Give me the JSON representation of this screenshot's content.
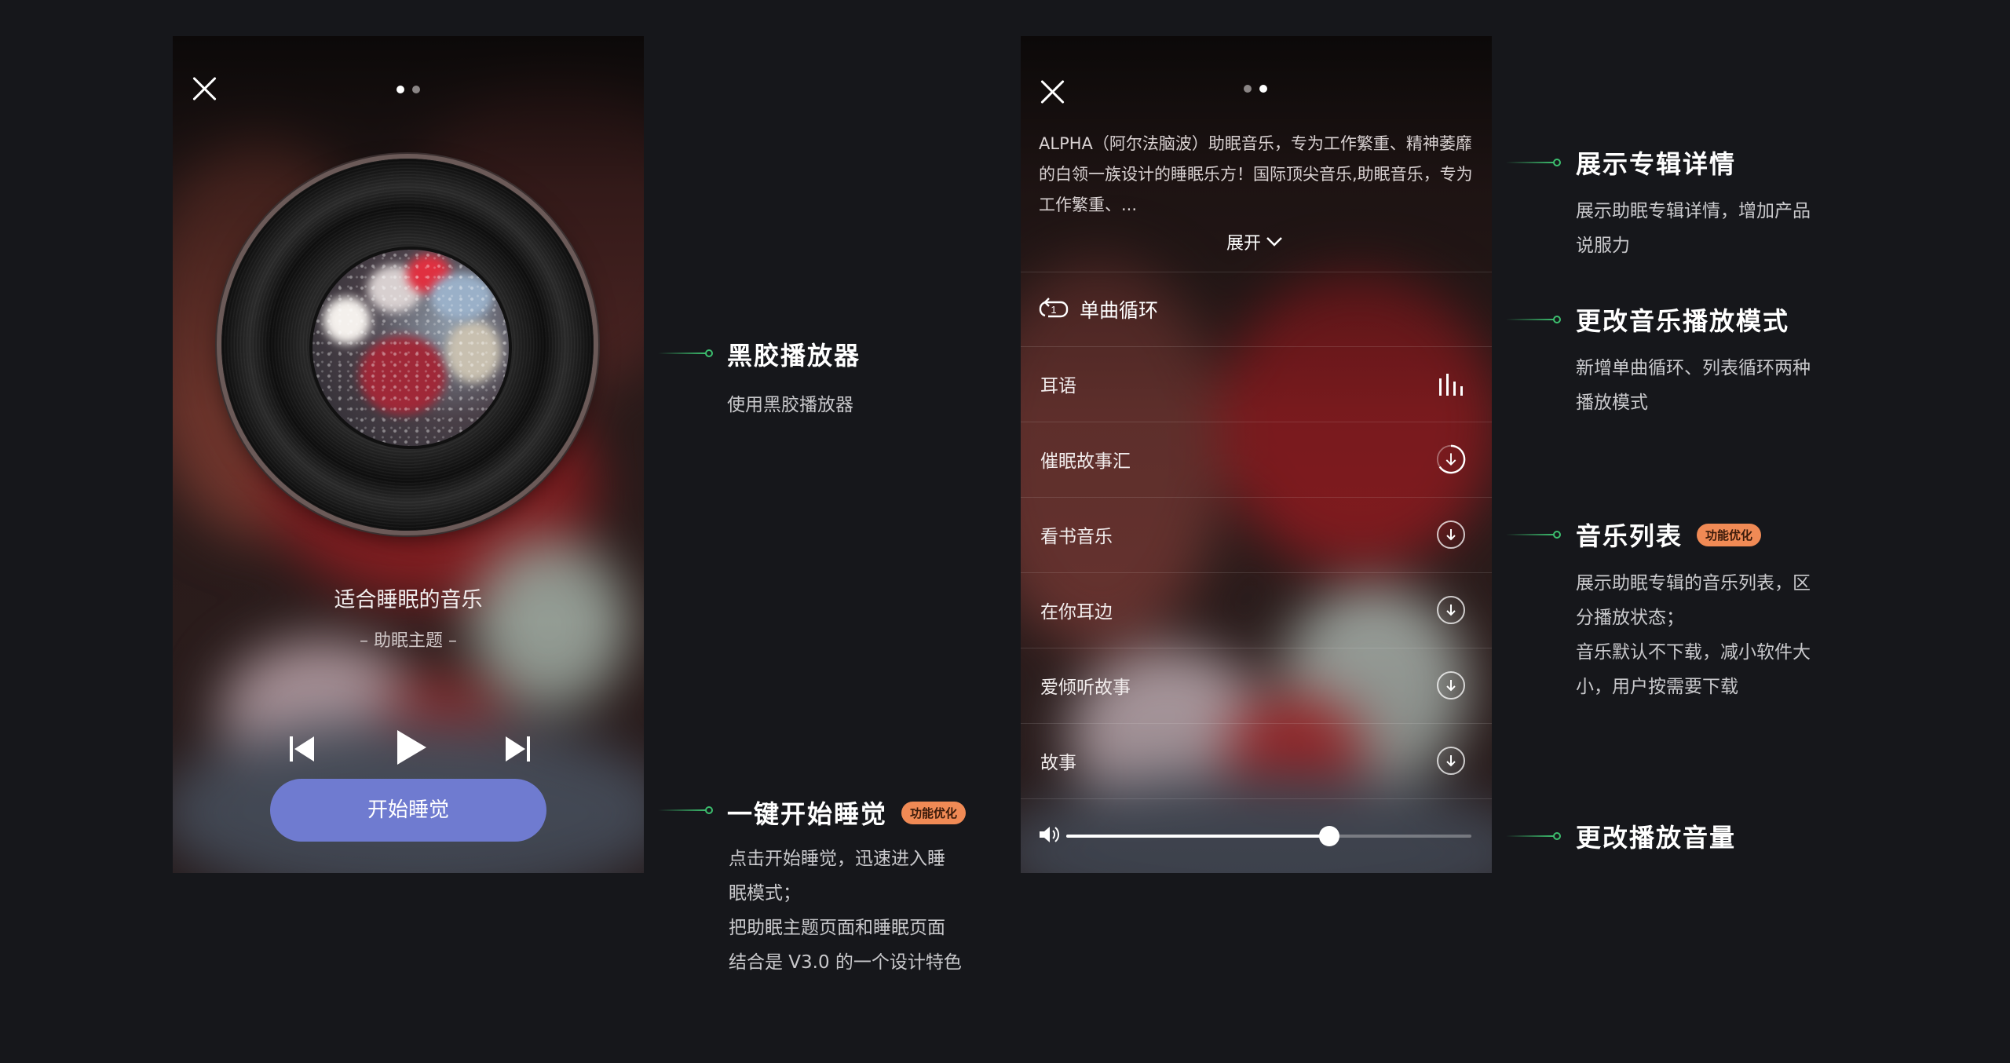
{
  "colors": {
    "background": "#16171b",
    "accent_green": "#3cbe6e",
    "button": "#6f7bd0",
    "badge": "#f08a55"
  },
  "icons": {
    "close": "close-icon",
    "prev": "skip-previous-icon",
    "play": "play-icon",
    "next": "skip-next-icon",
    "repeat_one": "repeat-one-icon",
    "equalizer": "equalizer-icon",
    "download": "download-icon",
    "downloading": "downloading-icon",
    "volume": "volume-icon",
    "expand": "chevron-down-icon"
  },
  "screen1": {
    "song_title": "适合睡眠的音乐",
    "song_subtitle": "– 助眠主题 –",
    "start_button": "开始睡觉"
  },
  "screen2": {
    "description": "ALPHA（阿尔法脑波）助眠音乐，专为工作繁重、精神萎靡的白领一族设计的睡眠乐方！国际顶尖音乐,助眠音乐，专为工作繁重、...",
    "expand": "展开",
    "mode": "单曲循环",
    "tracks": [
      {
        "title": "耳语",
        "state": "playing"
      },
      {
        "title": "催眠故事汇",
        "state": "downloading"
      },
      {
        "title": "看书音乐",
        "state": "download"
      },
      {
        "title": "在你耳边",
        "state": "download"
      },
      {
        "title": "爱倾听故事",
        "state": "download"
      },
      {
        "title": "故事",
        "state": "download"
      }
    ],
    "volume_fraction": 0.65
  },
  "annotations": {
    "vinyl": {
      "title": "黑胶播放器",
      "body": [
        "使用黑胶播放器"
      ]
    },
    "start": {
      "title": "一键开始睡觉",
      "badge": "功能优化",
      "body": [
        "点击开始睡觉，迅速进入睡",
        "眠模式；",
        "把助眠主题页面和睡眠页面",
        "结合是 V3.0 的一个设计特色"
      ]
    },
    "album": {
      "title": "展示专辑详情",
      "body": [
        "展示助眠专辑详情，增加产品",
        "说服力"
      ]
    },
    "mode": {
      "title": "更改音乐播放模式",
      "body": [
        "新增单曲循环、列表循环两种",
        "播放模式"
      ]
    },
    "list": {
      "title": "音乐列表",
      "badge": "功能优化",
      "body": [
        "展示助眠专辑的音乐列表，区",
        "分播放状态；",
        "音乐默认不下载，减小软件大",
        "小，用户按需要下载"
      ]
    },
    "volume": {
      "title": "更改播放音量"
    }
  }
}
